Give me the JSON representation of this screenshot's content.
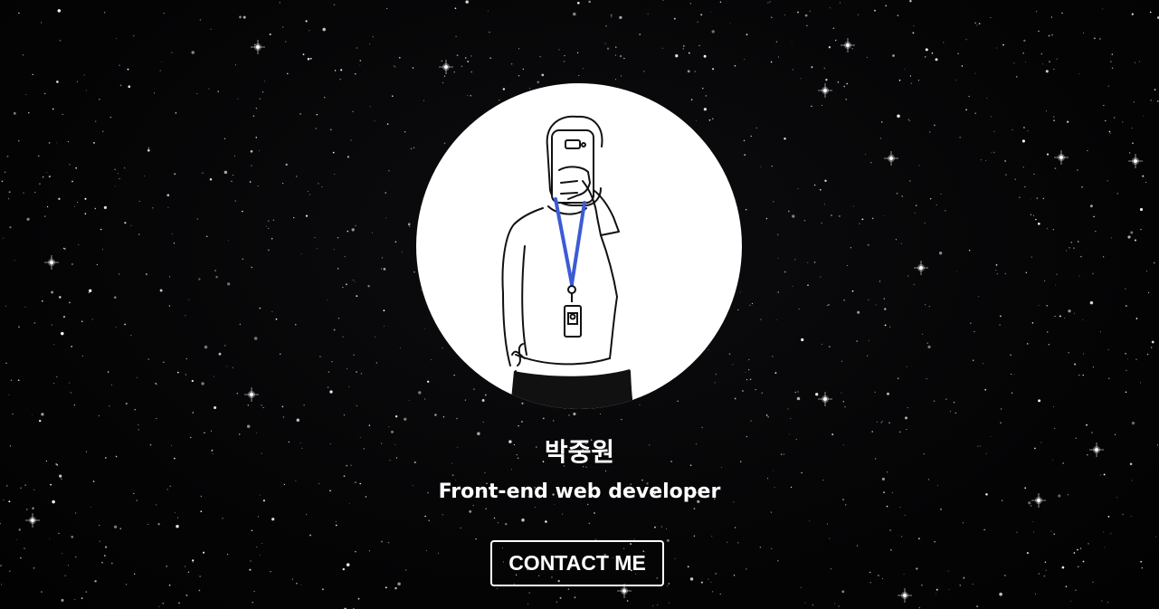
{
  "profile": {
    "name": "박중원",
    "role": "Front-end web developer",
    "avatar_icon": "person-with-phone-illustration",
    "lanyard_color": "#3b5bd6"
  },
  "actions": {
    "contact_label": "CONTACT ME"
  },
  "background": {
    "theme": "starfield",
    "base_color": "#050505",
    "star_color": "#ffffff"
  }
}
